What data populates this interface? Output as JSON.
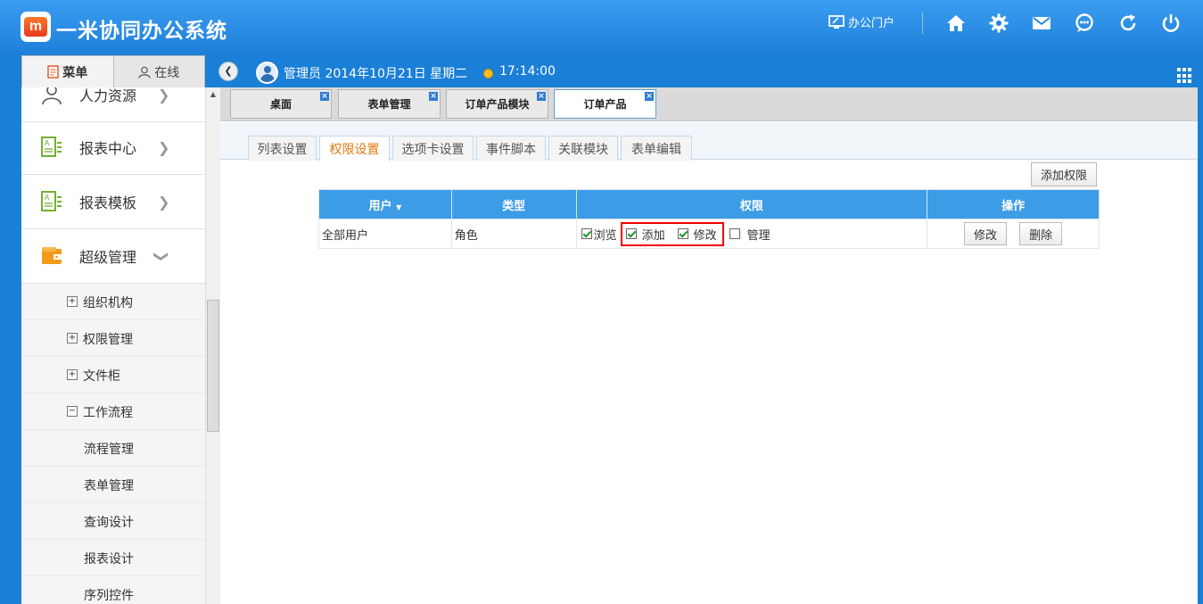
{
  "header": {
    "logo_text": "m",
    "app_title": "一米协同办公系统",
    "portal_label": "办公门户",
    "icons": [
      "home-icon",
      "gear-icon",
      "mail-icon",
      "chat-icon",
      "refresh-icon",
      "power-icon"
    ]
  },
  "infobar": {
    "menu_tab": "菜单",
    "online_tab": "在线",
    "user_info": "管理员 2014年10月21日 星期二",
    "time": "17:14:00"
  },
  "sidebar": {
    "items": [
      {
        "label": "人力资源",
        "icon": "person-icon"
      },
      {
        "label": "报表中心",
        "icon": "report-icon"
      },
      {
        "label": "报表模板",
        "icon": "template-icon"
      },
      {
        "label": "超级管理",
        "icon": "wallet-icon"
      }
    ],
    "sub_items": [
      {
        "label": "组织机构",
        "expander": "+"
      },
      {
        "label": "权限管理",
        "expander": "+"
      },
      {
        "label": "文件柜",
        "expander": "+"
      },
      {
        "label": "工作流程",
        "expander": "−"
      },
      {
        "label": "流程管理"
      },
      {
        "label": "表单管理"
      },
      {
        "label": "查询设计"
      },
      {
        "label": "报表设计"
      },
      {
        "label": "序列控件"
      }
    ]
  },
  "page_tabs": [
    "桌面",
    "表单管理",
    "订单产品模块",
    "订单产品"
  ],
  "page_tab_close": "×",
  "sub_tabs": [
    "列表设置",
    "权限设置",
    "选项卡设置",
    "事件脚本",
    "关联模块",
    "表单编辑"
  ],
  "add_permission_button": "添加权限",
  "table": {
    "headers": {
      "user": "用户",
      "sort_icon": "▼",
      "type": "类型",
      "permission": "权限",
      "operation": "操作"
    },
    "rows": [
      {
        "user": "全部用户",
        "type": "角色",
        "permissions": {
          "browse": {
            "label": "浏览",
            "checked": true
          },
          "add": {
            "label": "添加",
            "checked": true
          },
          "modify": {
            "label": "修改",
            "checked": true
          },
          "manage": {
            "label": "管理",
            "checked": false
          }
        },
        "edit_button": "修改",
        "delete_button": "删除"
      }
    ]
  },
  "colors": {
    "header_blue": "#1c7ed7",
    "table_header": "#3c9ce6",
    "active_subtab": "#e07a10",
    "highlight": "#e00000"
  }
}
